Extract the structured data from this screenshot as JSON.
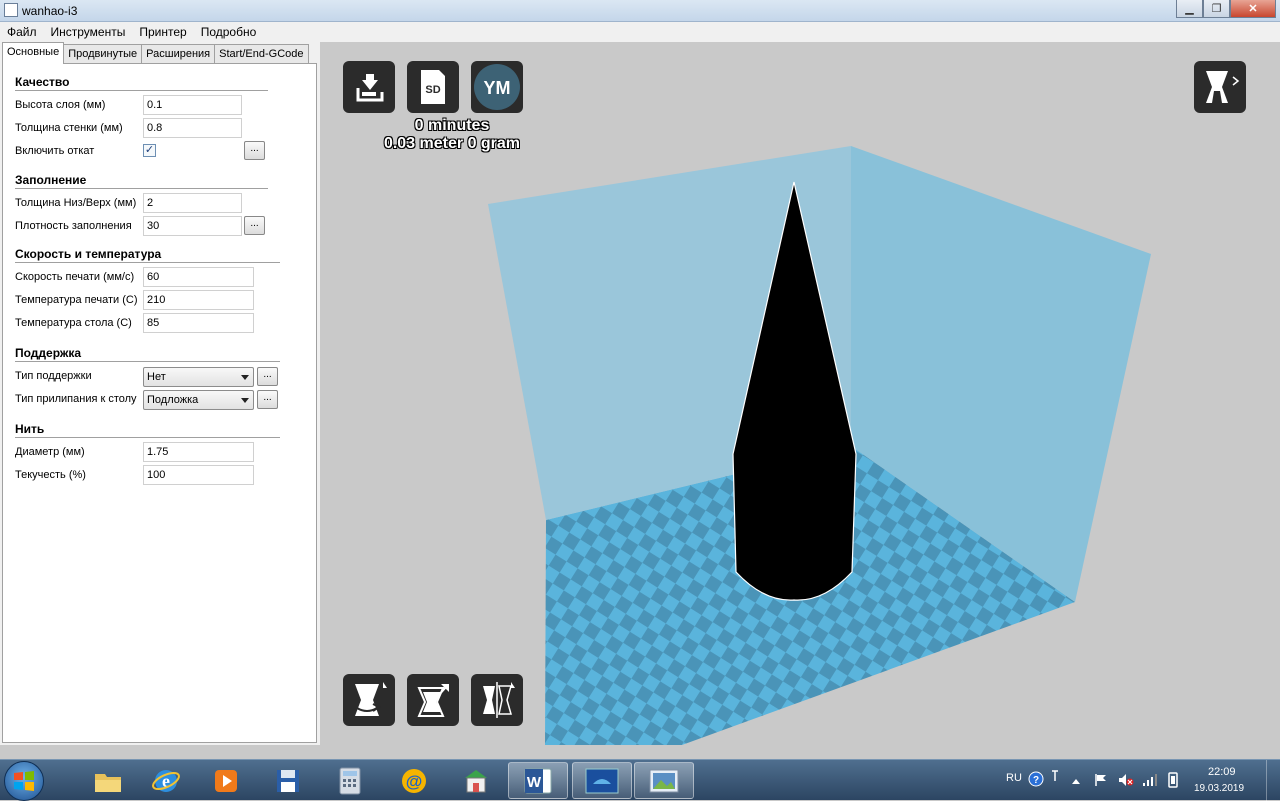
{
  "window": {
    "title": "wanhao-i3"
  },
  "menu": [
    "Файл",
    "Инструменты",
    "Принтер",
    "Подробно"
  ],
  "tabs": [
    "Основные",
    "Продвинутые",
    "Расширения",
    "Start/End-GCode"
  ],
  "sections": {
    "quality": {
      "title": "Качество",
      "layer_height_label": "Высота слоя (мм)",
      "layer_height": "0.1",
      "shell_label": "Толщина стенки (мм)",
      "shell": "0.8",
      "retraction_label": "Включить откат",
      "retraction_checked": true
    },
    "fill": {
      "title": "Заполнение",
      "bottom_top_label": "Толщина Низ/Верх (мм)",
      "bottom_top": "2",
      "density_label": "Плотность заполнения",
      "density": "30"
    },
    "speed": {
      "title": "Скорость и температура",
      "print_speed_label": "Скорость печати (мм/с)",
      "print_speed": "60",
      "print_temp_label": "Температура печати (C)",
      "print_temp": "210",
      "bed_temp_label": "Температура стола (C)",
      "bed_temp": "85"
    },
    "support": {
      "title": "Поддержка",
      "support_type_label": "Тип поддержки",
      "support_type": "Нет",
      "adhesion_label": "Тип прилипания к столу",
      "adhesion": "Подложка"
    },
    "filament": {
      "title": "Нить",
      "diameter_label": "Диаметр (мм)",
      "diameter": "1.75",
      "flow_label": "Текучесть (%)",
      "flow": "100"
    }
  },
  "dots_label": "...",
  "viewport": {
    "status_time": "0 minutes",
    "status_material": "0.03 meter 0 gram",
    "buttons": {
      "load": "load-icon",
      "sd": "SD",
      "ym": "YM",
      "view_mode": "view-mode-icon",
      "rotate": "rotate-icon",
      "scale": "scale-icon",
      "mirror": "mirror-icon"
    }
  },
  "taskbar": {
    "language": "RU",
    "time": "22:09",
    "date": "19.03.2019",
    "apps": [
      "explorer-icon",
      "internet-explorer-icon",
      "media-player-icon",
      "save-app-icon",
      "calculator-icon",
      "mail-icon",
      "store-icon",
      "word-icon",
      "wanhao-icon",
      "image-viewer-icon"
    ]
  },
  "colors": {
    "bed": "#5ab4dc",
    "bed_alt": "#4a94b8",
    "walls": "#7ec3e0",
    "object": "#000000"
  }
}
